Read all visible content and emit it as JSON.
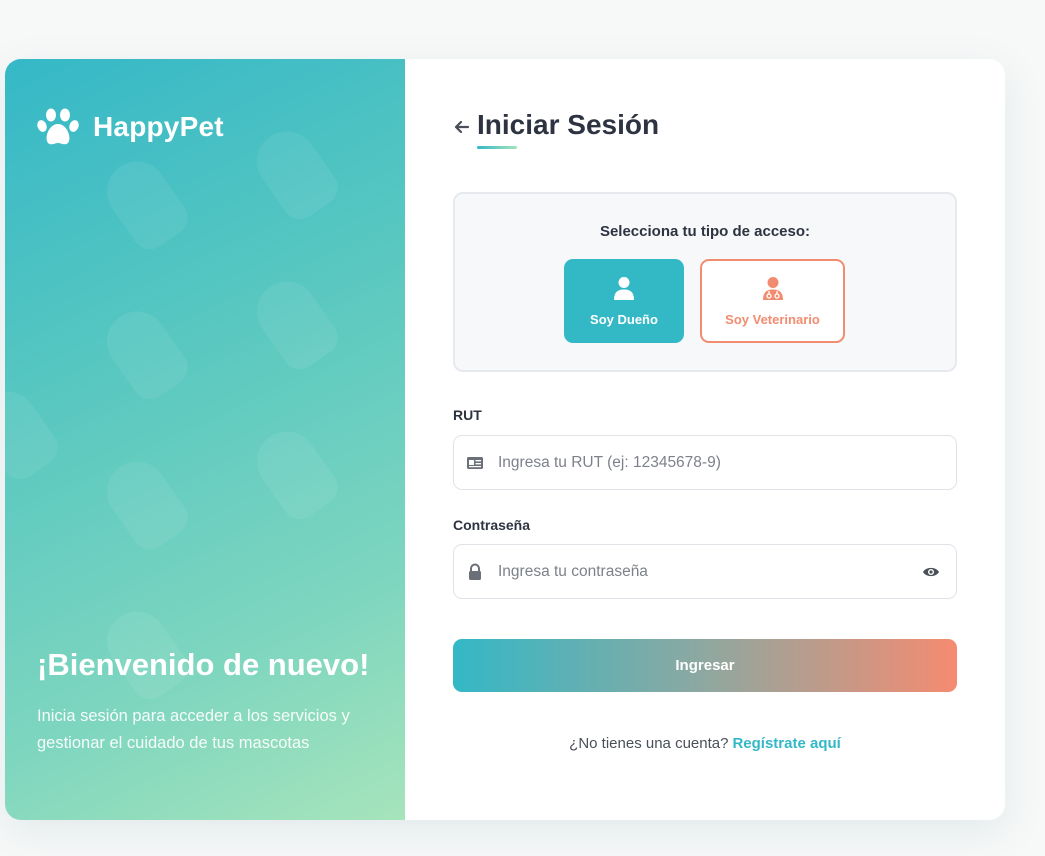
{
  "brand": {
    "name": "HappyPet",
    "icon": "paw-icon"
  },
  "welcome": {
    "heading": "¡Bienvenido de nuevo!",
    "text": "Inicia sesión para acceder a los servicios y gestionar el cuidado de tus mascotas"
  },
  "login": {
    "title": "Iniciar Sesión",
    "access_prompt": "Selecciona tu tipo de acceso:",
    "roles": [
      {
        "label": "Soy Dueño",
        "icon": "user-icon",
        "selected": true
      },
      {
        "label": "Soy Veterinario",
        "icon": "doctor-icon",
        "selected": false
      }
    ],
    "rut": {
      "label": "RUT",
      "placeholder": "Ingresa tu RUT (ej: 12345678-9)",
      "value": "",
      "icon": "id-card-icon"
    },
    "password": {
      "label": "Contraseña",
      "placeholder": "Ingresa tu contraseña",
      "value": "",
      "icon": "lock-icon",
      "toggle_icon": "eye-icon"
    },
    "submit_label": "Ingresar",
    "register_prompt": "¿No tienes una cuenta?",
    "register_link": "Regístrate aquí"
  },
  "colors": {
    "primary": "#33b8c6",
    "accent": "#f28c70",
    "gradient_end": "#a6e4bb"
  }
}
